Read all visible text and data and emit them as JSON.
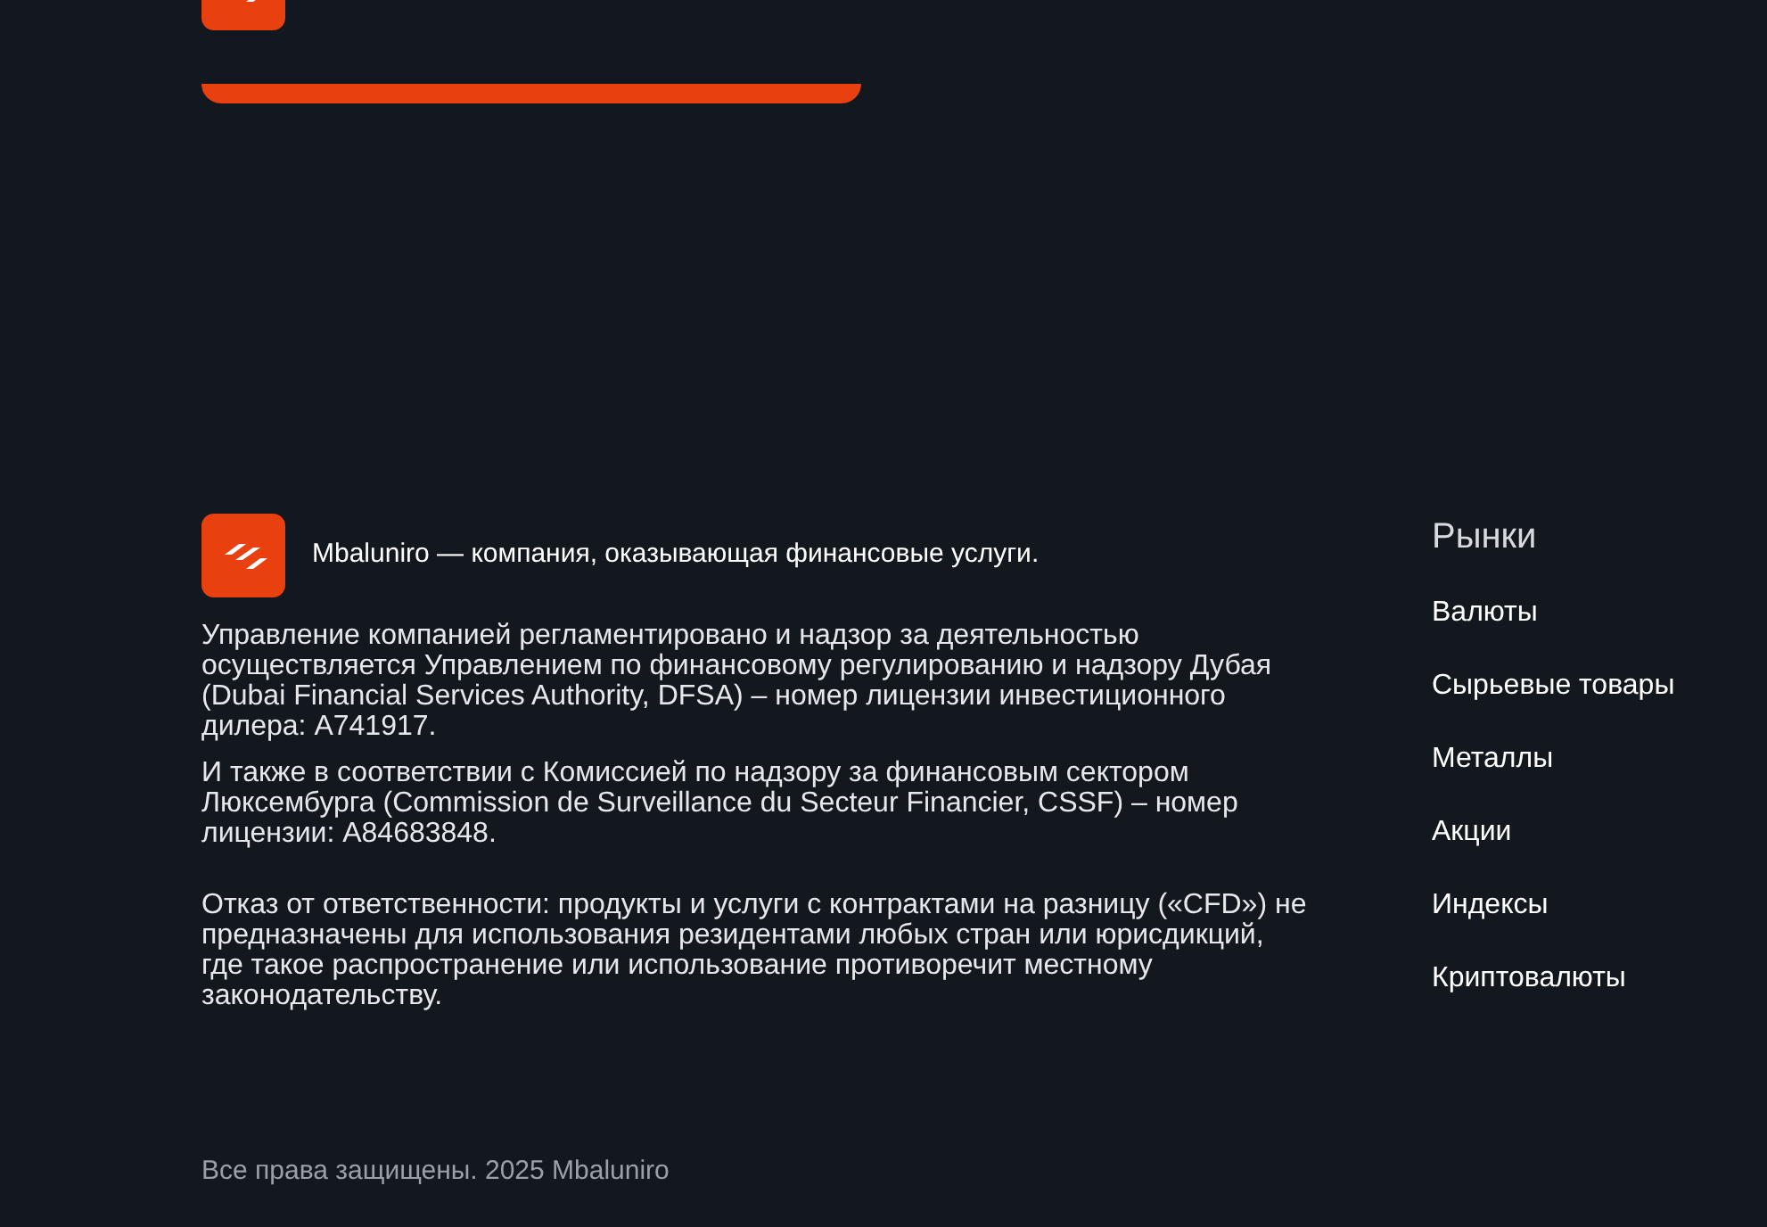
{
  "footer": {
    "tagline": "Mbaluniro — компания, оказывающая финансовые услуги.",
    "paragraphs": [
      "Управление компанией регламентировано и надзор за деятельностью осуществляется Управлением по финансовому регулированию и надзору Дубая (Dubai Financial Services Authority, DFSA) – номер лицензии инвестиционного дилера: A741917.",
      "И также в соответствии с Комиссией по надзору за финансовым сектором Люксембурга (Commission de Surveillance du Secteur Financier, CSSF) – номер лицензии: A84683848.",
      "Отказ от ответственности: продукты и услуги с контрактами на разницу («CFD») не предназначены для использования резидентами любых стран или юрисдикций, где такое распространение или использование противоречит местному законодательству."
    ],
    "menu": {
      "title": "Рынки",
      "items": [
        "Валюты",
        "Сырьевые товары",
        "Металлы",
        "Акции",
        "Индексы",
        "Криптовалюты"
      ]
    },
    "copyright": "Все права защищены. 2025 Mbaluniro"
  }
}
